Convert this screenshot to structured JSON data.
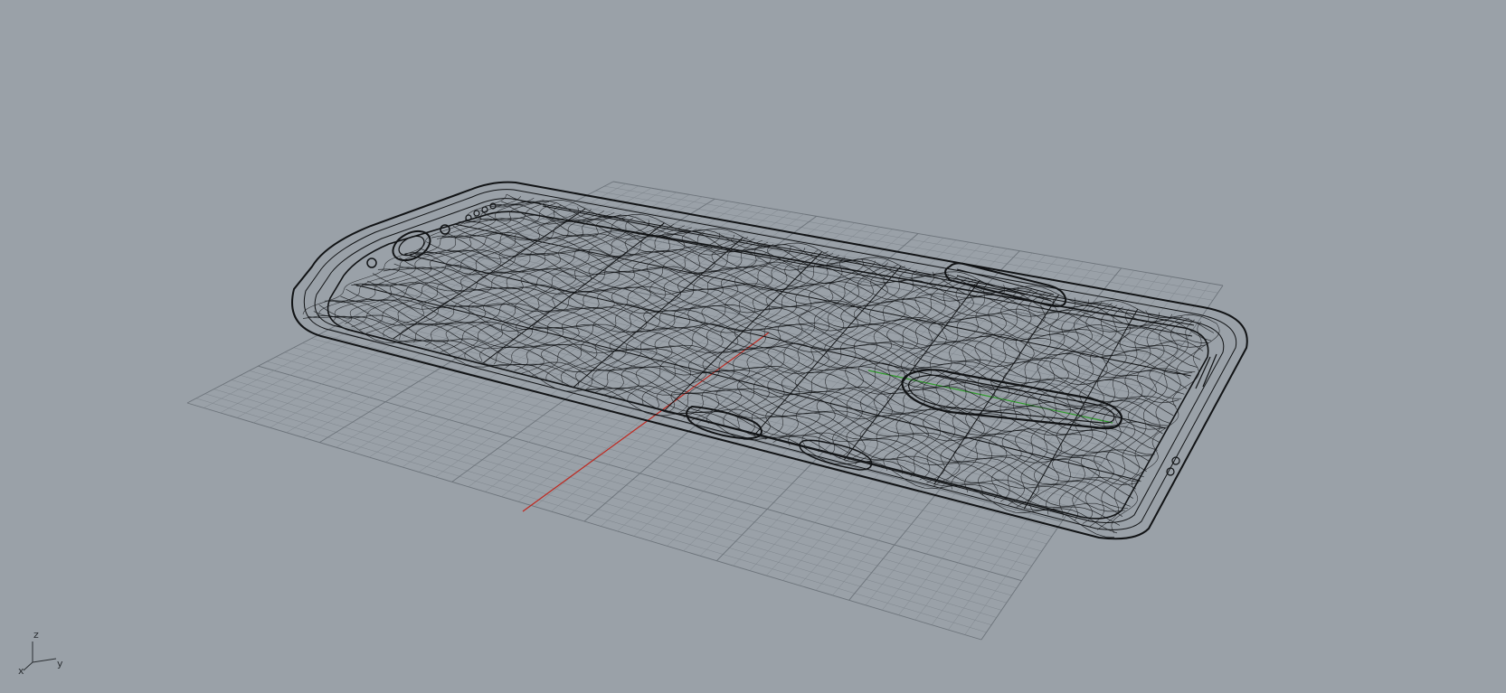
{
  "viewport": {
    "background": "#9aa1a8",
    "grid_color": "#7f868d",
    "grid_major_color": "#6c737a",
    "x_axis_color": "#c0281f",
    "y_axis_color": "#2f9a2a",
    "wire_color": "#111315"
  },
  "model": {
    "kind": "phone-case-wireframe"
  },
  "axis_widget": {
    "z_label": "z",
    "y_label": "y",
    "x_label": "x"
  }
}
